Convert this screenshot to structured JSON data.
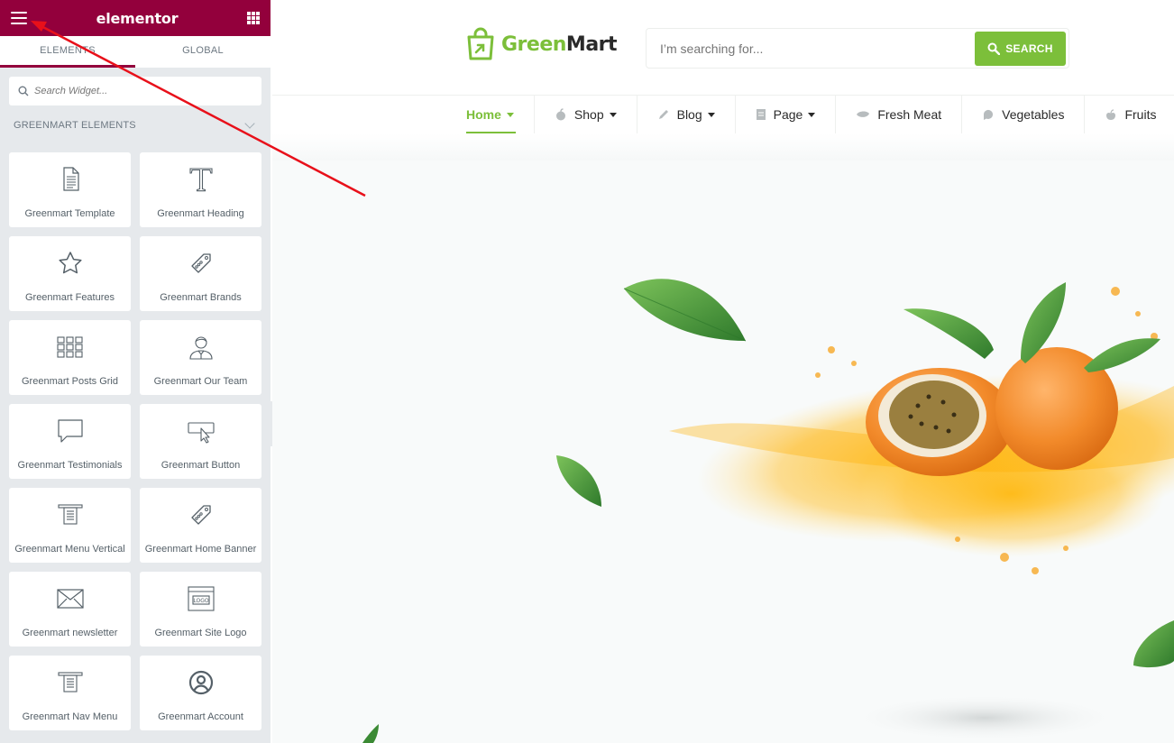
{
  "panel": {
    "brand": "elementor",
    "tabs": [
      {
        "label": "ELEMENTS",
        "active": true
      },
      {
        "label": "GLOBAL",
        "active": false
      }
    ],
    "search_placeholder": "Search Widget...",
    "section_title": "GREENMART ELEMENTS",
    "widgets": [
      {
        "label": "Greenmart Template",
        "icon": "document-icon"
      },
      {
        "label": "Greenmart Heading",
        "icon": "heading-t-icon"
      },
      {
        "label": "Greenmart Features",
        "icon": "star-icon"
      },
      {
        "label": "Greenmart Brands",
        "icon": "tag-icon"
      },
      {
        "label": "Greenmart Posts Grid",
        "icon": "posts-grid-icon"
      },
      {
        "label": "Greenmart Our Team",
        "icon": "team-person-icon"
      },
      {
        "label": "Greenmart Testimonials",
        "icon": "speech-bubble-icon"
      },
      {
        "label": "Greenmart Button",
        "icon": "button-cursor-icon"
      },
      {
        "label": "Greenmart Menu Vertical",
        "icon": "menu-vertical-icon"
      },
      {
        "label": "Greenmart Home Banner",
        "icon": "tag-icon"
      },
      {
        "label": "Greenmart newsletter",
        "icon": "envelope-icon"
      },
      {
        "label": "Greenmart Site Logo",
        "icon": "site-logo-icon"
      },
      {
        "label": "Greenmart Nav Menu",
        "icon": "nav-menu-icon"
      },
      {
        "label": "Greenmart Account",
        "icon": "account-circle-icon"
      }
    ]
  },
  "site": {
    "logo_green": "Green",
    "logo_dark": "Mart",
    "search_placeholder": "I’m searching for...",
    "search_button": "SEARCH",
    "nav": [
      {
        "label": "Home",
        "dropdown": true,
        "active": true,
        "icon": ""
      },
      {
        "label": "Shop",
        "dropdown": true,
        "active": false,
        "icon": "apple-icon"
      },
      {
        "label": "Blog",
        "dropdown": true,
        "active": false,
        "icon": "pencil-icon"
      },
      {
        "label": "Page",
        "dropdown": true,
        "active": false,
        "icon": "page-icon"
      },
      {
        "label": "Fresh Meat",
        "dropdown": false,
        "active": false,
        "icon": "meat-icon"
      },
      {
        "label": "Vegetables",
        "dropdown": false,
        "active": false,
        "icon": "leaf-bubble-icon"
      },
      {
        "label": "Fruits",
        "dropdown": false,
        "active": false,
        "icon": "fruit-icon"
      }
    ]
  },
  "colors": {
    "elementor_header": "#93003c",
    "brand_green": "#7cbf3a",
    "annotation_arrow": "#e8101a"
  }
}
